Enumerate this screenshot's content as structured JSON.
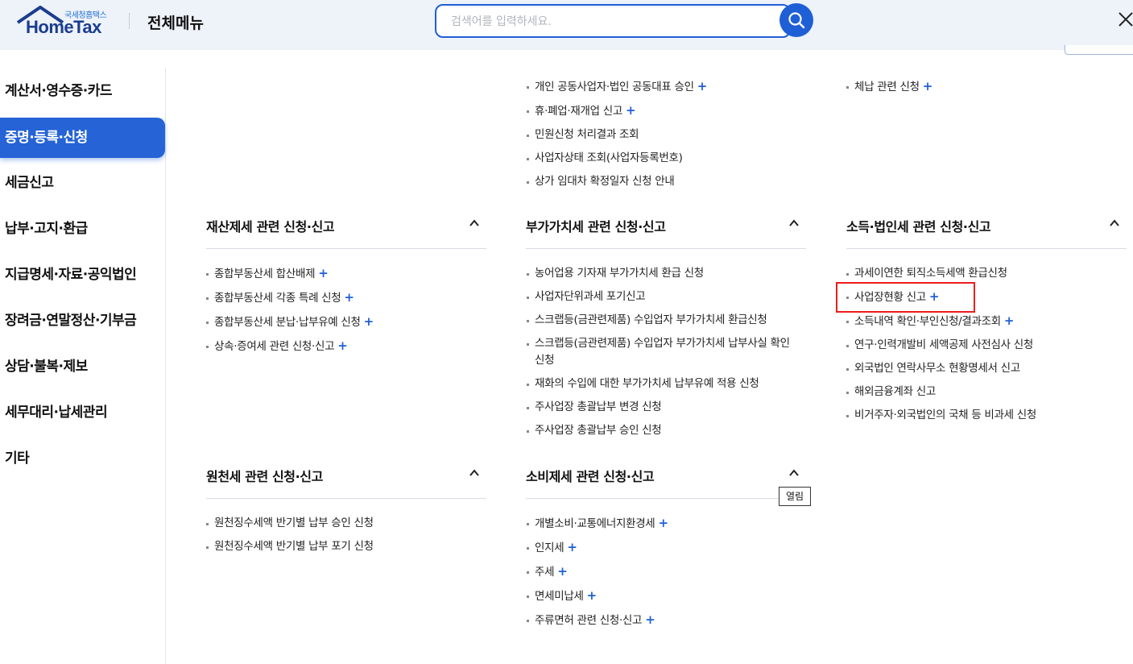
{
  "header": {
    "logo_sub": "국세청홈택스",
    "logo_main": "HomeTax",
    "title": "전체메뉴",
    "search_placeholder": "검색어를 입력하세요.",
    "accent_color": "#1f5fd6"
  },
  "sidebar": {
    "items": [
      {
        "label": "계산서·영수증·카드",
        "active": false
      },
      {
        "label": "증명·등록·신청",
        "active": true
      },
      {
        "label": "세금신고",
        "active": false
      },
      {
        "label": "납부·고지·환급",
        "active": false
      },
      {
        "label": "지급명세·자료·공익법인",
        "active": false
      },
      {
        "label": "장려금·연말정산·기부금",
        "active": false
      },
      {
        "label": "상담·불복·제보",
        "active": false
      },
      {
        "label": "세무대리·납세관리",
        "active": false
      },
      {
        "label": "기타",
        "active": false
      }
    ]
  },
  "top_lists": {
    "middle": [
      {
        "label": "개인 공동사업자·법인 공동대표 승인",
        "plus": "+"
      },
      {
        "label": "휴·폐업·재개업 신고",
        "plus": "+"
      },
      {
        "label": "민원신청 처리결과 조회",
        "plus": ""
      },
      {
        "label": "사업자상태 조회(사업자등록번호)",
        "plus": ""
      },
      {
        "label": "상가 임대차 확정일자 신청 안내",
        "plus": ""
      }
    ],
    "right": [
      {
        "label": "체납 관련 신청",
        "plus": "+"
      }
    ]
  },
  "sections": {
    "property": {
      "title": "재산제세 관련 신청·신고",
      "items": [
        {
          "label": "종합부동산세 합산배제",
          "plus": "+"
        },
        {
          "label": "종합부동산세 각종 특례 신청",
          "plus": "+"
        },
        {
          "label": "종합부동산세 분납·납부유예 신청",
          "plus": "+"
        },
        {
          "label": "상속·증여세 관련 신청·신고",
          "plus": "+"
        }
      ]
    },
    "vat": {
      "title": "부가가치세 관련 신청·신고",
      "items": [
        {
          "label": "농어업용 기자재 부가가치세 환급 신청",
          "plus": ""
        },
        {
          "label": "사업자단위과세 포기신고",
          "plus": ""
        },
        {
          "label": "스크랩등(금관련제품) 수입업자 부가가치세 환급신청",
          "plus": ""
        },
        {
          "label": "스크랩등(금관련제품) 수입업자 부가가치세 납부사실 확인신청",
          "plus": ""
        },
        {
          "label": "재화의 수입에 대한 부가가치세 납부유예 적용 신청",
          "plus": ""
        },
        {
          "label": "주사업장 총괄납부 변경 신청",
          "plus": ""
        },
        {
          "label": "주사업장 총괄납부 승인 신청",
          "plus": ""
        }
      ]
    },
    "income": {
      "title": "소득·법인세 관련 신청·신고",
      "items": [
        {
          "label": "과세이연한 퇴직소득세액 환급신청",
          "plus": ""
        },
        {
          "label": "사업장현황 신고",
          "plus": "+"
        },
        {
          "label": "소득내역 확인·부인신청/결과조회",
          "plus": "+"
        },
        {
          "label": "연구·인력개발비 세액공제 사전심사 신청",
          "plus": ""
        },
        {
          "label": "외국법인 연락사무소 현황명세서 신고",
          "plus": ""
        },
        {
          "label": "해외금융계좌 신고",
          "plus": ""
        },
        {
          "label": "비거주자·외국법인의 국채 등 비과세 신청",
          "plus": ""
        }
      ]
    },
    "withholding": {
      "title": "원천세 관련 신청·신고",
      "items": [
        {
          "label": "원천징수세액 반기별 납부 승인 신청",
          "plus": ""
        },
        {
          "label": "원천징수세액 반기별 납부 포기 신청",
          "plus": ""
        }
      ]
    },
    "consumption": {
      "title": "소비제세 관련 신청·신고",
      "items": [
        {
          "label": "개별소비·교통에너지환경세",
          "plus": "+"
        },
        {
          "label": "인지세",
          "plus": "+"
        },
        {
          "label": "주세",
          "plus": "+"
        },
        {
          "label": "면세미납세",
          "plus": "+"
        },
        {
          "label": "주류면허 관련 신청·신고",
          "plus": "+"
        }
      ]
    }
  },
  "tooltip": "열림",
  "highlight_color": "#ef1c1c"
}
